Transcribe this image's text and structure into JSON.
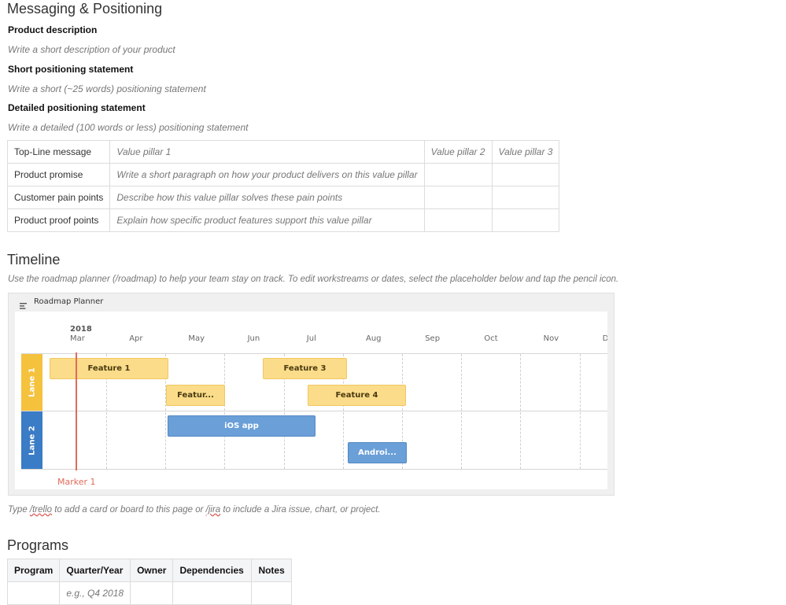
{
  "messaging": {
    "title": "Messaging & Positioning",
    "product_description_label": "Product description",
    "product_description_placeholder": "Write a short description of your product",
    "short_positioning_label": "Short positioning statement",
    "short_positioning_placeholder": "Write a short (~25 words) positioning statement",
    "detailed_positioning_label": "Detailed positioning statement",
    "detailed_positioning_placeholder": "Write a detailed (100 words or less) positioning statement"
  },
  "messaging_table": {
    "rows": [
      [
        "Top-Line message",
        "Value pillar 1",
        "Value pillar 2",
        "Value pillar 3"
      ],
      [
        "Product promise",
        "Write a short paragraph on how your product delivers on this value pillar",
        "",
        ""
      ],
      [
        "Customer pain points",
        "Describe how this value pillar solves these pain points",
        "",
        ""
      ],
      [
        "Product proof points",
        "Explain how specific product features support this value pillar",
        "",
        ""
      ]
    ]
  },
  "timeline": {
    "title": "Timeline",
    "description": "Use the roadmap planner (/roadmap) to help your team stay on track. To edit workstreams or dates, select the placeholder below and tap the pencil icon.",
    "footer_note_parts": [
      "Type ",
      "/trello",
      " to add a card or board to this page or ",
      "/jira",
      " to include a Jira issue, chart, or project."
    ]
  },
  "roadmap": {
    "header": "Roadmap Planner",
    "year": "2018",
    "months": [
      "Mar",
      "Apr",
      "May",
      "Jun",
      "Jul",
      "Aug",
      "Sep",
      "Oct",
      "Nov",
      "D"
    ],
    "lanes": [
      {
        "label": "Lane 1",
        "color": "#f5c23e"
      },
      {
        "label": "Lane 2",
        "color": "#3a7cc6"
      }
    ],
    "bars": [
      {
        "label": "Feature 1",
        "lane": 0,
        "row": 0
      },
      {
        "label": "Featur...",
        "lane": 0,
        "row": 1
      },
      {
        "label": "Feature 3",
        "lane": 0,
        "row": 0
      },
      {
        "label": "Feature 4",
        "lane": 0,
        "row": 1
      },
      {
        "label": "iOS app",
        "lane": 1,
        "row": 0
      },
      {
        "label": "Androi...",
        "lane": 1,
        "row": 1
      }
    ],
    "marker": {
      "label": "Marker 1",
      "color": "#e06b5a"
    }
  },
  "programs": {
    "title": "Programs",
    "headers": [
      "Program",
      "Quarter/Year",
      "Owner",
      "Dependencies",
      "Notes"
    ],
    "rows": [
      [
        "",
        "e.g., Q4 2018",
        "",
        "",
        ""
      ]
    ]
  }
}
